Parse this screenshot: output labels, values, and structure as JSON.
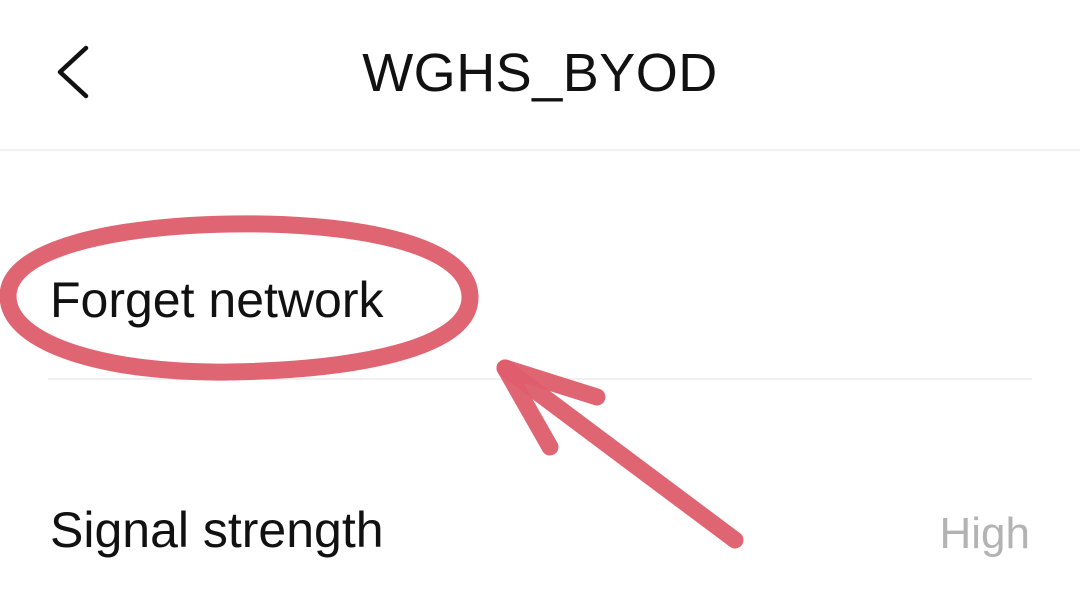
{
  "header": {
    "title": "WGHS_BYOD",
    "back_icon": "chevron-left-icon"
  },
  "rows": {
    "forget": {
      "label": "Forget network"
    },
    "signal": {
      "label": "Signal strength",
      "value": "High"
    }
  },
  "colors": {
    "background": "#ffffff",
    "text": "#111111",
    "secondary_text": "#b3b3b3",
    "divider": "#f0f0f0",
    "annotation": "#de5d6b"
  }
}
